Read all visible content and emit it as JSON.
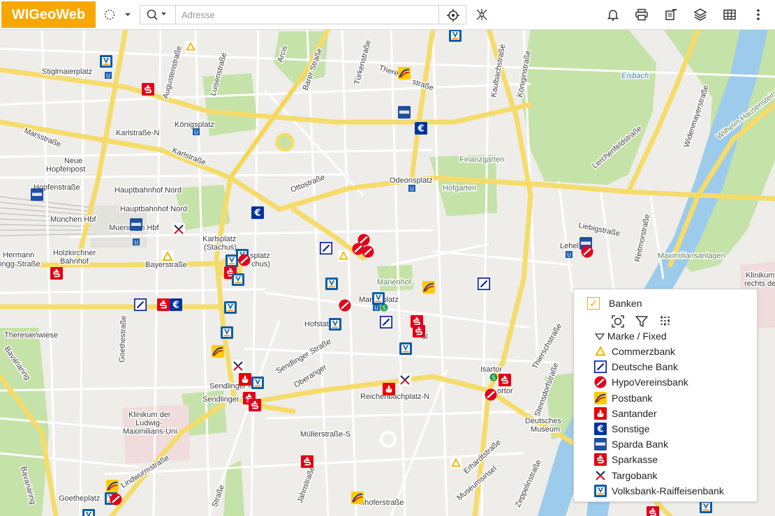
{
  "app": {
    "logo_text": "WIGeoWeb"
  },
  "search": {
    "placeholder": "Adresse",
    "value": ""
  },
  "toolbar": {
    "icons": [
      "lasso-select-icon",
      "chevron-down-icon",
      "search-icon",
      "locate-icon",
      "measure-icon",
      "bell-icon",
      "print-icon",
      "layer-edit-icon",
      "layers-icon",
      "table-icon",
      "more-icon"
    ]
  },
  "colors": {
    "brand": "#f6a800",
    "road_major": "#f7df6b",
    "road_minor": "#ffffff",
    "park": "#c3e1a6",
    "water": "#9ccbec",
    "land": "#f0efec"
  },
  "map": {
    "labels": {
      "stiglmaierplatz": "Stiglmaierplatz",
      "koenigsplatz": "Königsplatz",
      "karlstrasse_n": "Karlstraße-N",
      "karlstrasse": "Karlstraße",
      "marsstrasse": "Marsstraße",
      "neue": "Neue",
      "hopfenpost": "Hopfenpost",
      "hopfenstrasse": "Hopfenstraße",
      "hbf_nord": "Hauptbahnhof Nord",
      "hbf_nord2": "Hauptbahnhof Nord",
      "muenchen_hbf": "München Hbf",
      "muenchen_hbf2": "Muenchen Hbf",
      "hermann": "Hermann",
      "lingg": "ingg-Straße",
      "holzkirchner": "Holzkirchner",
      "bahnhof": "Bahnhof",
      "bayerstrasse": "Bayerstraße",
      "theresienwiese": "Theresienwiese",
      "bavariaring": "Bavariaring",
      "bavariaring2": "Bavariaring",
      "karlsplatz": "Karlsplatz",
      "stachus": "(Stachus)",
      "splatz": "splatz",
      "chus": "chus)",
      "ottostrasse": "Ottostraße",
      "odeonsplatz": "Odeonsplatz",
      "hofgarten": "Hofgarten",
      "finanzgarten": "Finanzgarten",
      "marienhof": "Marienhof",
      "marienplatz": "Marienplatz",
      "hofstatt": "Hofstatt",
      "sendlinger_str": "Sendlinger Straße",
      "oberanger": "Oberanger",
      "sendlinger_n": "Sendlinger N",
      "sendlinger_tor": "Sendlinger Tor",
      "reichenbach": "Reichenbachplatz-N",
      "muellerstrasse": "Müllerstraße-S",
      "isartor": "Isartor",
      "ortor": "ortor",
      "al": "al",
      "deutsches": "Deutsches",
      "museum": "Museum",
      "klinikum1": "Klinikum der",
      "klinikum2": "Ludwig-",
      "klinikum3": "Maximilians-Uni",
      "lindwurm": "Lindwurmstraße",
      "goetheplatz": "Goetheplatz",
      "goethestrasse": "Goethestraße",
      "jahnstrasse": "Jahnstraße",
      "strasse": "Straße",
      "fraunhofer": "nhoferstraße",
      "erhardt": "Erhardtstraße",
      "museumsinsel": "Museumsinsel",
      "zeppelin": "Zeppelinstraße",
      "steinsdorf": "Steinsdorfstraße",
      "thierschstr": "Thierschstraße",
      "liebigstrasse": "Liebigstraße",
      "lehel": "Lehel",
      "reitmorstrasse": "Reitmorstraße",
      "maximiliansanlagen": "Maximiliansanlagen",
      "widenmayer": "Widenmayerstraße",
      "lerchenfeld": "Lerchenfeldstraße",
      "eisbach": "Eisbach",
      "wilhelm": "Wilhelm-Hausenstein-Weg",
      "koeniginstrasse": "Königinstraße",
      "kaulbach": "Kaulbachstraße",
      "therese": "Therese",
      "strasse2": "straße",
      "tuerkenstrasse": "Türkenstraße",
      "barerstrasse": "Barer Straße",
      "arcis": "Arcis",
      "luisenstrasse": "Luisenstraße",
      "augustenstrasse": "Augustenstraße",
      "klinikum_r1": "Klinikum",
      "klinikum_r2": "rechts de"
    }
  },
  "legend": {
    "layer_title": "Banken",
    "group_label": "Marke / Fixed",
    "tool_icons": [
      "zoom-to-layer-icon",
      "filter-icon",
      "legend-style-icon"
    ],
    "items": [
      {
        "label": "Commerzbank",
        "icon": "commerzbank-icon"
      },
      {
        "label": "Deutsche Bank",
        "icon": "deutsche-bank-icon"
      },
      {
        "label": "HypoVereinsbank",
        "icon": "hypovereinsbank-icon"
      },
      {
        "label": "Postbank",
        "icon": "postbank-icon"
      },
      {
        "label": "Santander",
        "icon": "santander-icon"
      },
      {
        "label": "Sonstige",
        "icon": "sonstige-icon"
      },
      {
        "label": "Sparda Bank",
        "icon": "sparda-bank-icon"
      },
      {
        "label": "Sparkasse",
        "icon": "sparkasse-icon"
      },
      {
        "label": "Targobank",
        "icon": "targobank-icon"
      },
      {
        "label": "Volksbank-Raiffeisenbank",
        "icon": "volksbank-icon"
      }
    ]
  }
}
